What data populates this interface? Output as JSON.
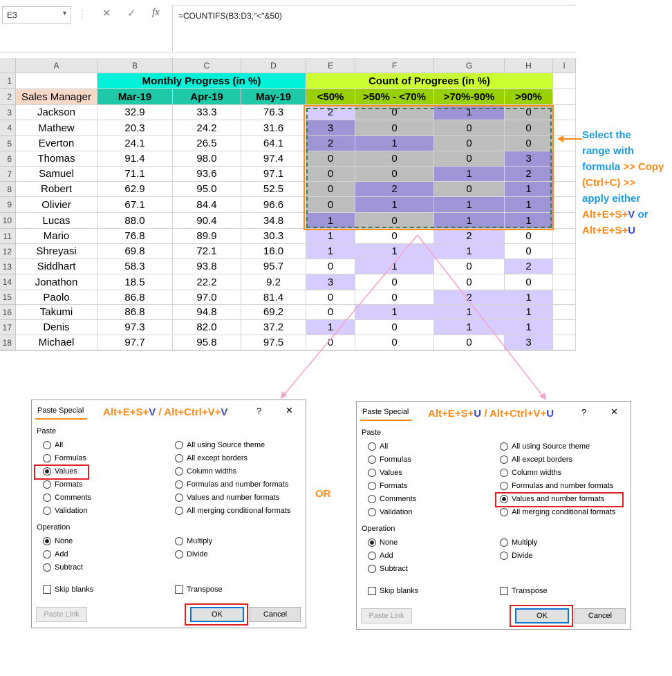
{
  "formula_bar": {
    "name_box": "E3",
    "cancel_glyph": "✕",
    "enter_glyph": "✓",
    "fx_glyph": "fx",
    "formula": "=COUNTIFS(B3:D3,\"<\"&50)"
  },
  "sheet": {
    "columns": [
      "A",
      "B",
      "C",
      "D",
      "E",
      "F",
      "G",
      "H",
      "I"
    ],
    "rows": [
      "1",
      "2",
      "3",
      "4",
      "5",
      "6",
      "7",
      "8",
      "9",
      "10",
      "11",
      "12",
      "13",
      "14",
      "15",
      "16",
      "17",
      "18"
    ],
    "header_group_1": "Monthly Progress (in %)",
    "header_group_2": "Count of Progrees (in %)",
    "col_headers": [
      "Sales Manager",
      "Mar-19",
      "Apr-19",
      "May-19",
      "<50%",
      ">50% - <70%",
      ">70%-90%",
      ">90%"
    ],
    "data": [
      [
        "Jackson",
        "32.9",
        "33.3",
        "76.3",
        "2",
        "0",
        "1",
        "0"
      ],
      [
        "Mathew",
        "20.3",
        "24.2",
        "31.6",
        "3",
        "0",
        "0",
        "0"
      ],
      [
        "Everton",
        "24.1",
        "26.5",
        "64.1",
        "2",
        "1",
        "0",
        "0"
      ],
      [
        "Thomas",
        "91.4",
        "98.0",
        "97.4",
        "0",
        "0",
        "0",
        "3"
      ],
      [
        "Samuel",
        "71.1",
        "93.6",
        "97.1",
        "0",
        "0",
        "1",
        "2"
      ],
      [
        "Robert",
        "62.9",
        "95.0",
        "52.5",
        "0",
        "2",
        "0",
        "1"
      ],
      [
        "Olivier",
        "67.1",
        "84.4",
        "96.6",
        "0",
        "1",
        "1",
        "1"
      ],
      [
        "Lucas",
        "88.0",
        "90.4",
        "34.8",
        "1",
        "0",
        "1",
        "1"
      ],
      [
        "Mario",
        "76.8",
        "89.9",
        "30.3",
        "1",
        "0",
        "2",
        "0"
      ],
      [
        "Shreyasi",
        "69.8",
        "72.1",
        "16.0",
        "1",
        "1",
        "1",
        "0"
      ],
      [
        "Siddhart",
        "58.3",
        "93.8",
        "95.7",
        "0",
        "1",
        "0",
        "2"
      ],
      [
        "Jonathon",
        "18.5",
        "22.2",
        "9.2",
        "3",
        "0",
        "0",
        "0"
      ],
      [
        "Paolo",
        "86.8",
        "97.0",
        "81.4",
        "0",
        "0",
        "2",
        "1"
      ],
      [
        "Takumi",
        "86.8",
        "94.8",
        "69.2",
        "0",
        "1",
        "1",
        "1"
      ],
      [
        "Denis",
        "97.3",
        "82.0",
        "37.2",
        "1",
        "0",
        "1",
        "1"
      ],
      [
        "Michael",
        "97.7",
        "95.8",
        "97.5",
        "0",
        "0",
        "0",
        "3"
      ]
    ]
  },
  "annotation": {
    "line1": "Select the",
    "line2": "range with",
    "line3a": "formula ",
    "line3b": ">> Copy",
    "line4": "(Ctrl+C) >>",
    "line5": "apply either",
    "line6a": "Alt+E+S+",
    "line6b": "V",
    "line6c": " or",
    "line7a": "Alt+E+S+",
    "line7b": "U",
    "or_label": "OR"
  },
  "dialog_left": {
    "title": "Paste Special",
    "help": "?",
    "close": "✕",
    "hint_a": "Alt+E+S+",
    "hint_b": "V",
    "hint_c": " / Alt+Ctrl+V+",
    "hint_d": "V",
    "paste_label": "Paste",
    "paste_left": [
      "All",
      "Formulas",
      "Values",
      "Formats",
      "Comments",
      "Validation"
    ],
    "paste_right": [
      "All using Source theme",
      "All except borders",
      "Column widths",
      "Formulas and number formats",
      "Values and number formats",
      "All merging conditional formats"
    ],
    "operation_label": "Operation",
    "op_left": [
      "None",
      "Add",
      "Subtract"
    ],
    "op_right": [
      "Multiply",
      "Divide"
    ],
    "skip_blanks": "Skip blanks",
    "transpose": "Transpose",
    "paste_link": "Paste Link",
    "ok": "OK",
    "cancel": "Cancel"
  },
  "dialog_right": {
    "title": "Paste Special",
    "help": "?",
    "close": "✕",
    "hint_a": "Alt+E+S+",
    "hint_b": "U",
    "hint_c": " / Alt+Ctrl+V+",
    "hint_d": "U",
    "paste_label": "Paste",
    "paste_left": [
      "All",
      "Formulas",
      "Values",
      "Formats",
      "Comments",
      "Validation"
    ],
    "paste_right": [
      "All using Source theme",
      "All except borders",
      "Column widths",
      "Formulas and number formats",
      "Values and number formats",
      "All merging conditional formats"
    ],
    "operation_label": "Operation",
    "op_left": [
      "None",
      "Add",
      "Subtract"
    ],
    "op_right": [
      "Multiply",
      "Divide"
    ],
    "skip_blanks": "Skip blanks",
    "transpose": "Transpose",
    "paste_link": "Paste Link",
    "ok": "OK",
    "cancel": "Cancel"
  }
}
